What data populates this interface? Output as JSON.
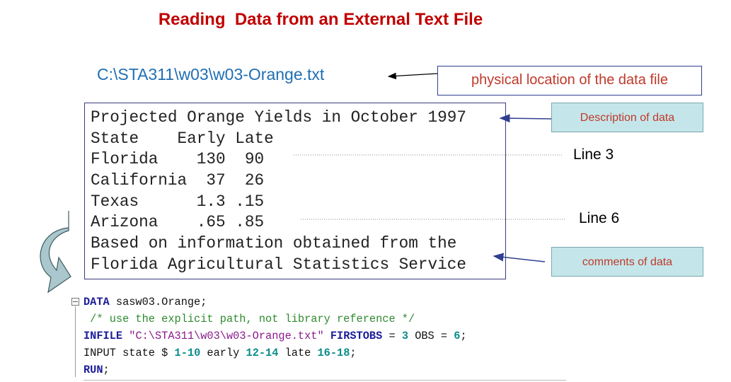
{
  "title": "Reading  Data from an External Text File",
  "file_path": "C:\\STA311\\w03\\w03-Orange.txt",
  "callouts": {
    "location": "physical location of the data file",
    "description": "Description of data",
    "comments": "comments of data"
  },
  "line_labels": {
    "line3": "Line 3",
    "line6": "Line 6"
  },
  "file_lines": [
    "Projected Orange Yields in October 1997",
    "State    Early Late",
    "Florida    130  90",
    "California  37  26",
    "Texas      1.3 .15",
    "Arizona    .65 .85",
    "Based on information obtained from the",
    "Florida Agricultural Statistics Service"
  ],
  "code": {
    "l1_kw": "DATA",
    "l1_rest": " sasw03.Orange;",
    "l2_comment": " /* use the explicit path, not library reference */",
    "l3_kw": "INFILE",
    "l3_str": "\"C:\\STA311\\w03\\w03-Orange.txt\"",
    "l3_opt1": "FIRSTOBS",
    "l3_eq1": " = ",
    "l3_n1": "3",
    "l3_opt2": " OBS",
    "l3_eq2": " = ",
    "l3_n2": "6",
    "l3_end": ";",
    "l4_kw": "INPUT",
    "l4_a": " state $ ",
    "l4_n1": "1-10",
    "l4_b": " early ",
    "l4_n2": "12-14",
    "l4_c": " late ",
    "l4_n3": "16-18",
    "l4_end": ";",
    "l5_kw": "RUN",
    "l5_end": ";"
  },
  "colors": {
    "title": "#c00000",
    "path": "#1f6fb4",
    "callout_text": "#c0392b",
    "callout_fill": "#c4e6ea",
    "arrow_fill": "#a9c7cc"
  }
}
